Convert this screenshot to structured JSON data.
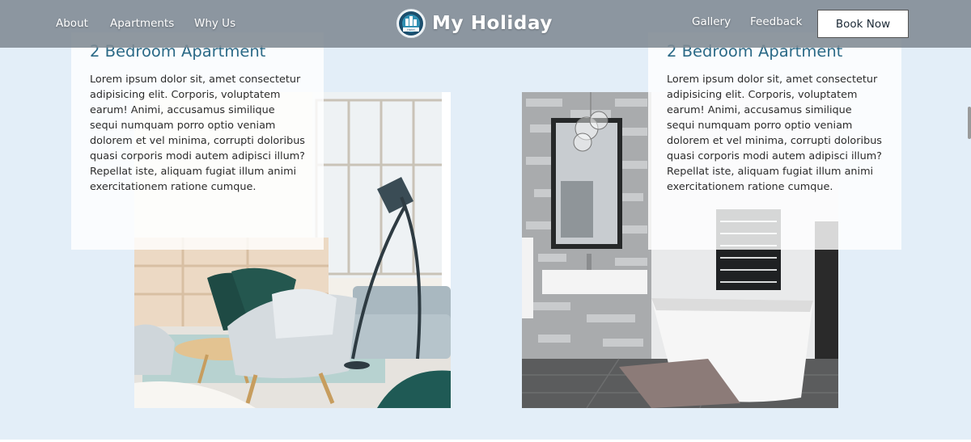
{
  "nav": {
    "left_links": [
      "About",
      "Apartments",
      "Why Us"
    ],
    "right_links": [
      "Gallery",
      "Feedback"
    ],
    "brand_name": "My Holiday",
    "logo_text": "Hotel",
    "book_button": "Book Now"
  },
  "cards": [
    {
      "title": "2 Bedroom Apartment",
      "text": "Lorem ipsum dolor sit, amet consectetur adipisicing elit. Corporis, voluptatem earum! Animi, accusamus similique sequi numquam porro optio veniam dolorem et vel minima, corrupti doloribus quasi corporis modi autem adipisci illum? Repellat iste, aliquam fugiat illum animi exercitationem ratione cumque."
    },
    {
      "title": "2 Bedroom Apartment",
      "text": "Lorem ipsum dolor sit, amet consectetur adipisicing elit. Corporis, voluptatem earum! Animi, accusamus similique sequi numquam porro optio veniam dolorem et vel minima, corrupti doloribus quasi corporis modi autem adipisci illum? Repellat iste, aliquam fugiat illum animi exercitationem ratione cumque."
    }
  ],
  "images": {
    "left": "living-room-photo",
    "right": "bathroom-photo"
  },
  "colors": {
    "background": "#e3eef8",
    "navbar": "#808a93",
    "title": "#2c6a87",
    "accent_teal": "#1f5a55"
  }
}
